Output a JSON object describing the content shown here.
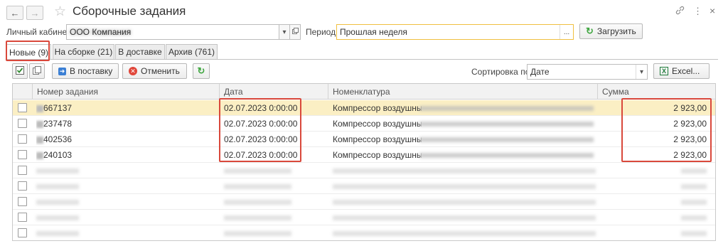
{
  "window": {
    "title": "Сборочные задания",
    "back_icon": "←",
    "forward_icon": "→",
    "star_icon": "☆",
    "link_icon": "🔗",
    "menu_icon": "⋮",
    "close_icon": "×"
  },
  "filters": {
    "cabinet_label": "Личный кабинет:",
    "cabinet_value": "ООО Компания",
    "period_label": "Период:",
    "period_value": "Прошлая неделя",
    "period_btn_label": "...",
    "load_button": "Загрузить"
  },
  "tabs": [
    {
      "label": "Новые (9)",
      "active": true
    },
    {
      "label": "На сборке (21)",
      "active": false
    },
    {
      "label": "В доставке",
      "active": false
    },
    {
      "label": "Архив (761)",
      "active": false
    }
  ],
  "toolbar": {
    "to_delivery": "В поставку",
    "cancel": "Отменить",
    "sort_label": "Сортировка по:",
    "sort_value": "Дате",
    "excel": "Excel..."
  },
  "table": {
    "columns": [
      "Номер задания",
      "Дата",
      "Номенклатура",
      "Сумма"
    ],
    "rows": [
      {
        "number": "667137",
        "date": "02.07.2023 0:00:00",
        "item": "Компрессор воздушный",
        "sum": "2 923,00"
      },
      {
        "number": "237478",
        "date": "02.07.2023 0:00:00",
        "item": "Компрессор воздушный",
        "sum": "2 923,00"
      },
      {
        "number": "402536",
        "date": "02.07.2023 0:00:00",
        "item": "Компрессор воздушный",
        "sum": "2 923,00"
      },
      {
        "number": "240103",
        "date": "02.07.2023 0:00:00",
        "item": "Компрессор воздушный",
        "sum": "2 923,00"
      }
    ]
  },
  "colors": {
    "selected_row": "#fbefc4",
    "highlight": "#d9483b",
    "period_border": "#f0c040",
    "load_icon": "#3fa640",
    "excel_icon": "#1e7b3a",
    "delivery_icon": "#3b7fd4",
    "cancel_icon": "#e0463a"
  }
}
